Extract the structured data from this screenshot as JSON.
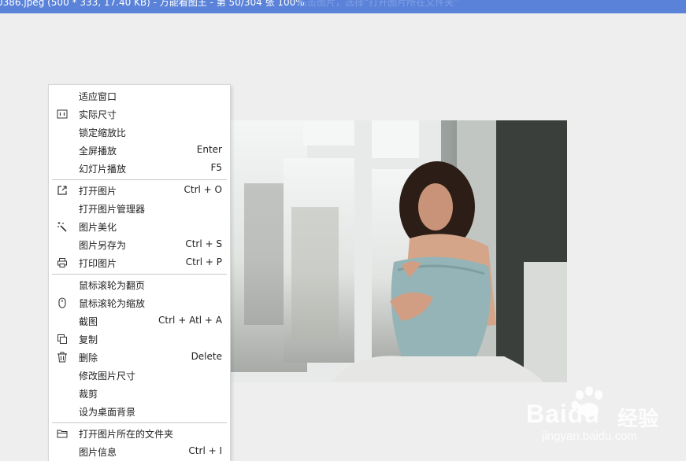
{
  "window": {
    "title": "0386.jpeg (500 * 333, 17.40 KB) - 万能看图王 - 第 50/304 张 100%",
    "ghost_text": "右击图片，选择“打开图片所在文件夹”",
    "titlebar_color": "#5a82d8",
    "background": "#eeeeee"
  },
  "context_menu": {
    "items": [
      {
        "label": "适应窗口",
        "shortcut": "",
        "icon": ""
      },
      {
        "label": "实际尺寸",
        "shortcut": "",
        "icon": "actual-size-icon"
      },
      {
        "label": "锁定缩放比",
        "shortcut": "",
        "icon": ""
      },
      {
        "label": "全屏播放",
        "shortcut": "Enter",
        "icon": ""
      },
      {
        "label": "幻灯片播放",
        "shortcut": "F5",
        "icon": ""
      },
      {
        "label": "打开图片",
        "shortcut": "Ctrl + O",
        "icon": "open-external-icon"
      },
      {
        "label": "打开图片管理器",
        "shortcut": "",
        "icon": ""
      },
      {
        "label": "图片美化",
        "shortcut": "",
        "icon": "magic-wand-icon"
      },
      {
        "label": "图片另存为",
        "shortcut": "Ctrl + S",
        "icon": ""
      },
      {
        "label": "打印图片",
        "shortcut": "Ctrl + P",
        "icon": "printer-icon"
      },
      {
        "label": "鼠标滚轮为翻页",
        "shortcut": "",
        "icon": ""
      },
      {
        "label": "鼠标滚轮为缩放",
        "shortcut": "",
        "icon": "mouse-icon"
      },
      {
        "label": "截图",
        "shortcut": "Ctrl + Atl + A",
        "icon": ""
      },
      {
        "label": "复制",
        "shortcut": "",
        "icon": "copy-icon"
      },
      {
        "label": "删除",
        "shortcut": "Delete",
        "icon": "trash-icon"
      },
      {
        "label": "修改图片尺寸",
        "shortcut": "",
        "icon": ""
      },
      {
        "label": "裁剪",
        "shortcut": "",
        "icon": ""
      },
      {
        "label": "设为桌面背景",
        "shortcut": "",
        "icon": ""
      },
      {
        "label": "打开图片所在的文件夹",
        "shortcut": "",
        "icon": "folder-icon"
      },
      {
        "label": "图片信息",
        "shortcut": "Ctrl + I",
        "icon": ""
      }
    ]
  },
  "watermark": {
    "brand": "Baidu",
    "cn": "经验",
    "url": "jingyan.baidu.com"
  }
}
